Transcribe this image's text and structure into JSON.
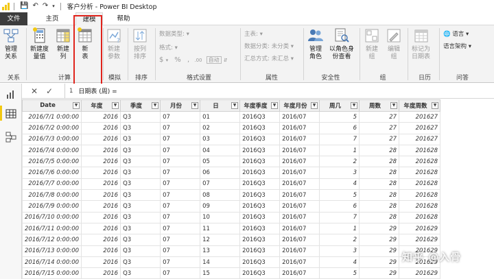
{
  "window": {
    "title": "客户分析 - Power BI Desktop",
    "accent": "#f2c811"
  },
  "tabs": [
    {
      "label": "文件"
    },
    {
      "label": "主页"
    },
    {
      "label": "建模"
    },
    {
      "label": "帮助"
    }
  ],
  "ribbon": {
    "groups": {
      "relations": "关系",
      "calc": "计算",
      "whatif": "模拟",
      "sort": "排序",
      "format": "格式设置",
      "props": "属性",
      "security": "安全性",
      "group": "组",
      "calendar": "日历",
      "qa": "问答"
    },
    "buttons": {
      "manage_rel_1": "管理",
      "manage_rel_2": "关系",
      "new_measure_1": "新建度",
      "new_measure_2": "量值",
      "new_col_1": "新建",
      "new_col_2": "列",
      "new_table_1": "新",
      "new_table_2": "表",
      "new_param_1": "新建",
      "new_param_2": "参数",
      "sort_col_1": "按列",
      "sort_col_2": "排序",
      "manage_roles_1": "管理",
      "manage_roles_2": "角色",
      "view_as_1": "以角色身",
      "view_as_2": "份查看",
      "new_group_1": "新建",
      "new_group_2": "组",
      "edit_group_1": "编辑",
      "edit_group_2": "组",
      "mark_date_1": "标记为",
      "mark_date_2": "日期表",
      "language": "语言",
      "linguistic": "语言架构"
    },
    "format": {
      "data_type": "数据类型:",
      "format": "格式:",
      "currency": "$",
      "percent": "%",
      "comma": ",",
      "decimal": ".00",
      "auto": "自动"
    },
    "props": {
      "home_table": "主表:",
      "data_category": "数据分类: 未分类",
      "summarize": "汇总方式: 未汇总"
    }
  },
  "formula": {
    "line": "1",
    "text": "日期表 (周)  ="
  },
  "table": {
    "columns": [
      "Date",
      "年度",
      "季度",
      "月份",
      "日",
      "年度季度",
      "年度月份",
      "周几",
      "周数",
      "年度周数"
    ],
    "rows": [
      [
        "2016/7/1 0:00:00",
        "2016",
        "Q3",
        "07",
        "01",
        "2016Q3",
        "2016/07",
        "5",
        "27",
        "201627"
      ],
      [
        "2016/7/2 0:00:00",
        "2016",
        "Q3",
        "07",
        "02",
        "2016Q3",
        "2016/07",
        "6",
        "27",
        "201627"
      ],
      [
        "2016/7/3 0:00:00",
        "2016",
        "Q3",
        "07",
        "03",
        "2016Q3",
        "2016/07",
        "7",
        "27",
        "201627"
      ],
      [
        "2016/7/4 0:00:00",
        "2016",
        "Q3",
        "07",
        "04",
        "2016Q3",
        "2016/07",
        "1",
        "28",
        "201628"
      ],
      [
        "2016/7/5 0:00:00",
        "2016",
        "Q3",
        "07",
        "05",
        "2016Q3",
        "2016/07",
        "2",
        "28",
        "201628"
      ],
      [
        "2016/7/6 0:00:00",
        "2016",
        "Q3",
        "07",
        "06",
        "2016Q3",
        "2016/07",
        "3",
        "28",
        "201628"
      ],
      [
        "2016/7/7 0:00:00",
        "2016",
        "Q3",
        "07",
        "07",
        "2016Q3",
        "2016/07",
        "4",
        "28",
        "201628"
      ],
      [
        "2016/7/8 0:00:00",
        "2016",
        "Q3",
        "07",
        "08",
        "2016Q3",
        "2016/07",
        "5",
        "28",
        "201628"
      ],
      [
        "2016/7/9 0:00:00",
        "2016",
        "Q3",
        "07",
        "09",
        "2016Q3",
        "2016/07",
        "6",
        "28",
        "201628"
      ],
      [
        "2016/7/10 0:00:00",
        "2016",
        "Q3",
        "07",
        "10",
        "2016Q3",
        "2016/07",
        "7",
        "28",
        "201628"
      ],
      [
        "2016/7/11 0:00:00",
        "2016",
        "Q3",
        "07",
        "11",
        "2016Q3",
        "2016/07",
        "1",
        "29",
        "201629"
      ],
      [
        "2016/7/12 0:00:00",
        "2016",
        "Q3",
        "07",
        "12",
        "2016Q3",
        "2016/07",
        "2",
        "29",
        "201629"
      ],
      [
        "2016/7/13 0:00:00",
        "2016",
        "Q3",
        "07",
        "13",
        "2016Q3",
        "2016/07",
        "3",
        "29",
        "201629"
      ],
      [
        "2016/7/14 0:00:00",
        "2016",
        "Q3",
        "07",
        "14",
        "2016Q3",
        "2016/07",
        "4",
        "29",
        "201629"
      ],
      [
        "2016/7/15 0:00:00",
        "2016",
        "Q3",
        "07",
        "15",
        "2016Q3",
        "2016/07",
        "5",
        "29",
        "201629"
      ]
    ]
  },
  "watermark": "知乎 @入骨"
}
